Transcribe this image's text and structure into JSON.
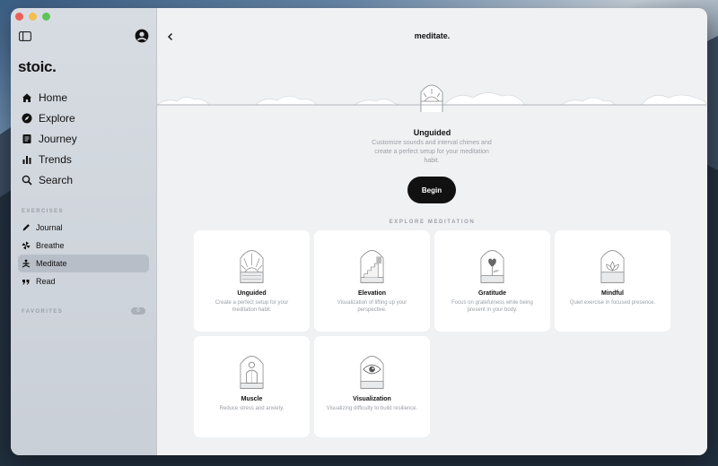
{
  "app": {
    "brand": "stoic.",
    "title": "meditate."
  },
  "sidebar": {
    "nav": [
      {
        "label": "Home",
        "icon": "home-icon"
      },
      {
        "label": "Explore",
        "icon": "compass-icon"
      },
      {
        "label": "Journey",
        "icon": "journal-book-icon"
      },
      {
        "label": "Trends",
        "icon": "bar-chart-icon"
      },
      {
        "label": "Search",
        "icon": "search-icon"
      }
    ],
    "exercises_label": "EXERCISES",
    "exercises": [
      {
        "label": "Journal",
        "icon": "pen-icon"
      },
      {
        "label": "Breathe",
        "icon": "pinwheel-icon"
      },
      {
        "label": "Meditate",
        "icon": "meditate-icon",
        "active": true
      },
      {
        "label": "Read",
        "icon": "quote-icon"
      }
    ],
    "favorites_label": "FAVORITES",
    "favorites_count": "0"
  },
  "hero": {
    "title": "Unguided",
    "description": "Customize sounds and interval chimes and create a perfect setup for your meditation habit.",
    "button": "Begin"
  },
  "explore_label": "EXPLORE MEDITATION",
  "cards": [
    {
      "title": "Unguided",
      "description": "Create a perfect setup for your meditation habit.",
      "icon": "sunrise-arch-icon"
    },
    {
      "title": "Elevation",
      "description": "Visualization of lifting up your perspective.",
      "icon": "stairs-arch-icon"
    },
    {
      "title": "Gratitude",
      "description": "Focus on gratefulness while being present in your body.",
      "icon": "heart-plant-arch-icon"
    },
    {
      "title": "Mindful",
      "description": "Quiet exercise in focused presence.",
      "icon": "lotus-arch-icon"
    },
    {
      "title": "Muscle",
      "description": "Reduce stress and anxiety.",
      "icon": "person-arch-icon"
    },
    {
      "title": "Visualization",
      "description": "Visualizing difficulty to build resilience.",
      "icon": "eye-arch-icon"
    }
  ],
  "colors": {
    "accent": "#111111",
    "background": "#f0f1f3",
    "card": "#ffffff",
    "muted_text": "#9a9ea5",
    "active_item": "#b8bec7"
  }
}
